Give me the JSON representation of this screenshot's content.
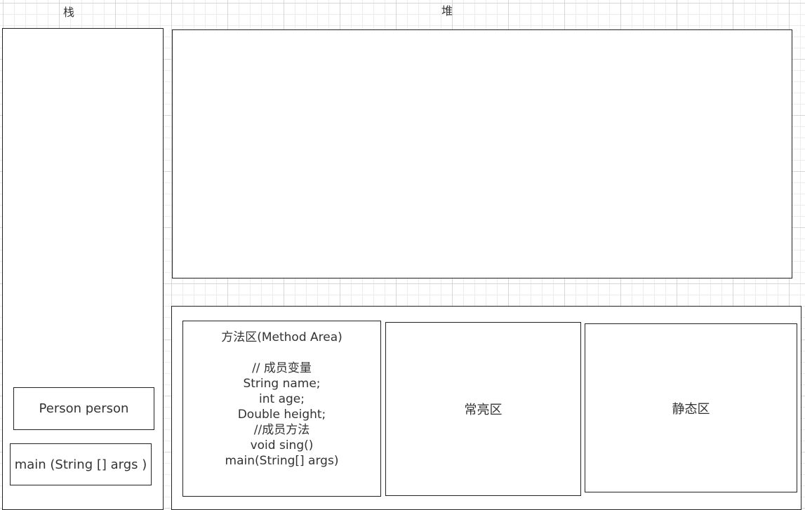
{
  "stack": {
    "title": "栈",
    "frames": [
      {
        "label": "Person person"
      },
      {
        "label": "main (String [] args )"
      }
    ]
  },
  "heap": {
    "title": "堆"
  },
  "method_area": {
    "title": "方法区(Method Area)",
    "lines": [
      "// 成员变量",
      "String name;",
      "int age;",
      "Double height;",
      "//成员方法",
      "void sing()",
      "main(String[] args)"
    ]
  },
  "constant_area": {
    "label": "常亮区"
  },
  "static_area": {
    "label": "静态区"
  }
}
